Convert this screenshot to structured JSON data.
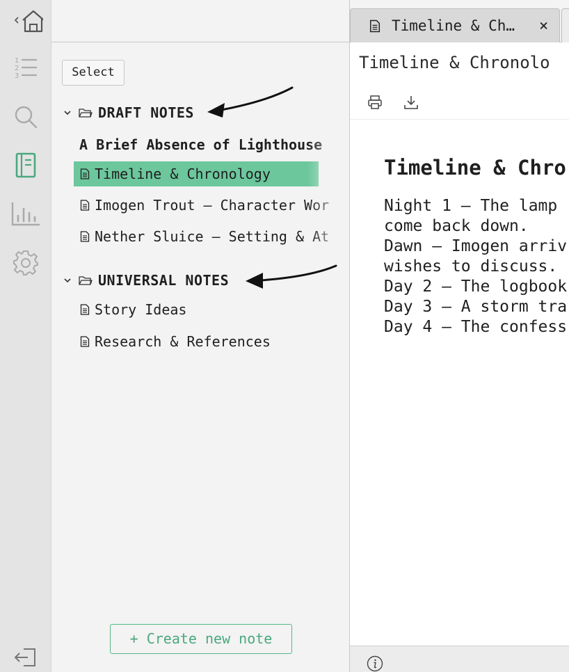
{
  "rail": {
    "items": [
      "home-icon",
      "numbered-list-icon",
      "search-icon",
      "notebook-icon",
      "chart-icon",
      "settings-icon",
      "logout-icon"
    ],
    "accent": "#4aa87e"
  },
  "sidebar": {
    "select_label": "Select",
    "groups": [
      {
        "title": "DRAFT NOTES",
        "draft_title": "A Brief Absence of Lighthouse",
        "notes": [
          {
            "label": "Timeline & Chronology",
            "active": true
          },
          {
            "label": "Imogen Trout — Character Wor",
            "active": false
          },
          {
            "label": "Nether Sluice — Setting & At",
            "active": false
          }
        ]
      },
      {
        "title": "UNIVERSAL NOTES",
        "notes": [
          {
            "label": "Story Ideas",
            "active": false
          },
          {
            "label": "Research & References",
            "active": false
          }
        ]
      }
    ],
    "create_label": "+ Create new note",
    "active_color": "#6cc79c"
  },
  "editor": {
    "tab_label": "Timeline & Ch…",
    "tab_close": "×",
    "doc_name": "Timeline & Chronolo",
    "heading": "Timeline & Chro",
    "lines": [
      "Night 1 — The lamp",
      "come back down.",
      "Dawn — Imogen arriv",
      "wishes to discuss.",
      "Day 2 — The logbook",
      "Day 3 — A storm tra",
      "Day 4 — The confess"
    ]
  }
}
